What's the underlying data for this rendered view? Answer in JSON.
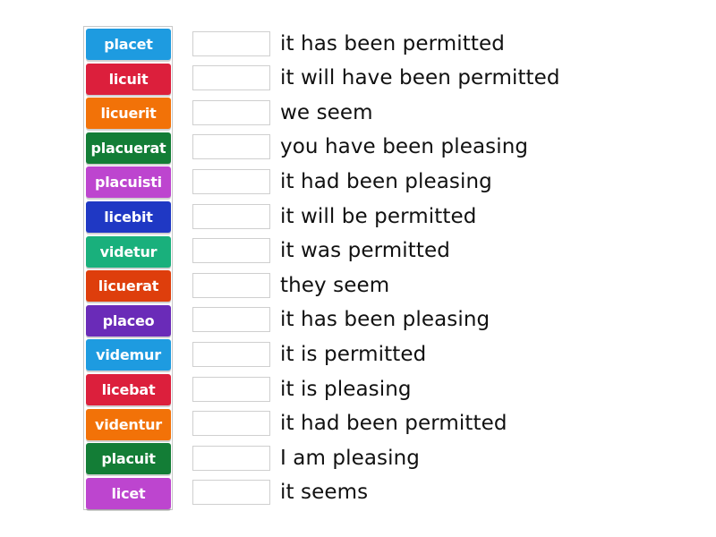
{
  "tiles": [
    {
      "label": "placet",
      "color": "#1e9be0"
    },
    {
      "label": "licuit",
      "color": "#dc1f3c"
    },
    {
      "label": "licuerit",
      "color": "#f27208"
    },
    {
      "label": "placuerat",
      "color": "#137d36"
    },
    {
      "label": "placuisti",
      "color": "#bd45cf"
    },
    {
      "label": "licebit",
      "color": "#1f38c4"
    },
    {
      "label": "videtur",
      "color": "#19b07c"
    },
    {
      "label": "licuerat",
      "color": "#de3e0c"
    },
    {
      "label": "placeo",
      "color": "#6a2bb8"
    },
    {
      "label": "videmur",
      "color": "#1e9be0"
    },
    {
      "label": "licebat",
      "color": "#dc1f3c"
    },
    {
      "label": "videntur",
      "color": "#f27208"
    },
    {
      "label": "placuit",
      "color": "#137d36"
    },
    {
      "label": "licet",
      "color": "#bd45cf"
    }
  ],
  "targets": [
    {
      "phrase": "it has been permitted",
      "answer": ""
    },
    {
      "phrase": "it will have been permitted",
      "answer": ""
    },
    {
      "phrase": "we seem",
      "answer": ""
    },
    {
      "phrase": "you have been pleasing",
      "answer": ""
    },
    {
      "phrase": "it had been pleasing",
      "answer": ""
    },
    {
      "phrase": "it will be permitted",
      "answer": ""
    },
    {
      "phrase": "it was permitted",
      "answer": ""
    },
    {
      "phrase": "they seem",
      "answer": ""
    },
    {
      "phrase": "it has been pleasing",
      "answer": ""
    },
    {
      "phrase": "it is permitted",
      "answer": ""
    },
    {
      "phrase": "it is pleasing",
      "answer": ""
    },
    {
      "phrase": "it had been permitted",
      "answer": ""
    },
    {
      "phrase": "I am pleasing",
      "answer": ""
    },
    {
      "phrase": "it seems",
      "answer": ""
    }
  ]
}
